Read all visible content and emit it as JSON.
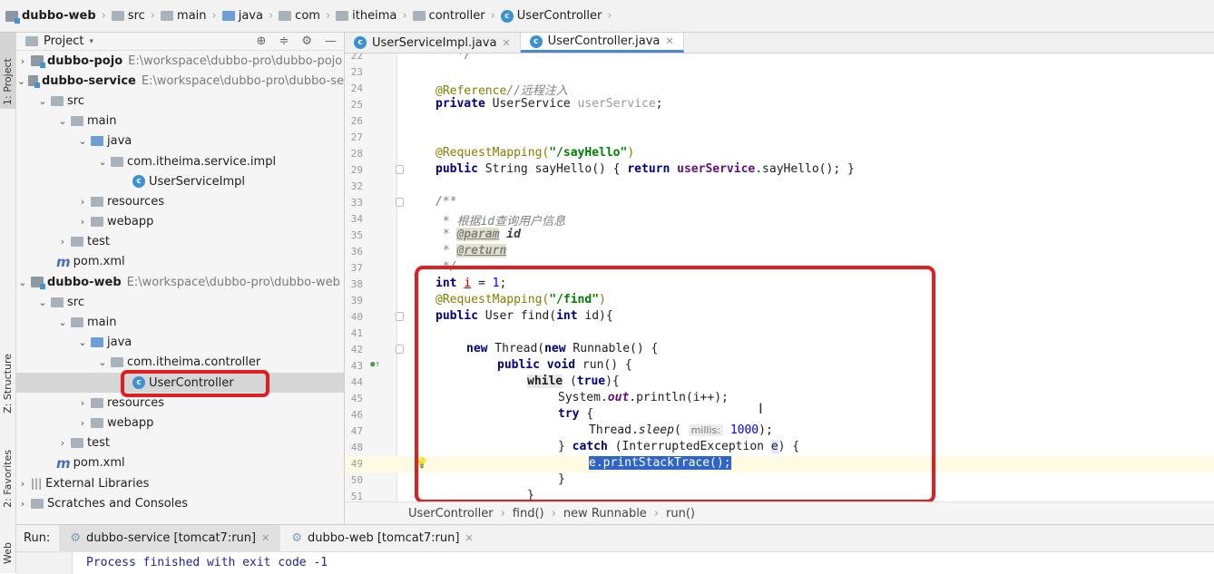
{
  "breadcrumb": [
    "dubbo-web",
    "src",
    "main",
    "java",
    "com",
    "itheima",
    "controller",
    "UserController"
  ],
  "sidebar_tabs": {
    "project": "1: Project",
    "structure": "Z: Structure",
    "favorites": "2: Favorites",
    "web": "Web"
  },
  "project_panel": {
    "title": "Project"
  },
  "tree": [
    {
      "label": "dubbo-pojo",
      "path": "E:\\workspace\\dubbo-pro\\dubbo-pojo"
    },
    {
      "label": "dubbo-service",
      "path": "E:\\workspace\\dubbo-pro\\dubbo-se"
    },
    {
      "label": "src"
    },
    {
      "label": "main"
    },
    {
      "label": "java"
    },
    {
      "label": "com.itheima.service.impl"
    },
    {
      "label": "UserServiceImpl"
    },
    {
      "label": "resources"
    },
    {
      "label": "webapp"
    },
    {
      "label": "test"
    },
    {
      "label": "pom.xml"
    },
    {
      "label": "dubbo-web",
      "path": "E:\\workspace\\dubbo-pro\\dubbo-web"
    },
    {
      "label": "src"
    },
    {
      "label": "main"
    },
    {
      "label": "java"
    },
    {
      "label": "com.itheima.controller"
    },
    {
      "label": "UserController"
    },
    {
      "label": "resources"
    },
    {
      "label": "webapp"
    },
    {
      "label": "test"
    },
    {
      "label": "pom.xml"
    },
    {
      "label": "External Libraries"
    },
    {
      "label": "Scratches and Consoles"
    }
  ],
  "editor_tabs": [
    "UserServiceImpl.java",
    "UserController.java"
  ],
  "line_numbers": [
    "22",
    "23",
    "24",
    "25",
    "26",
    "27",
    "28",
    "29",
    "32",
    "33",
    "34",
    "35",
    "36",
    "37",
    "38",
    "39",
    "40",
    "41",
    "42",
    "43",
    "44",
    "45",
    "46",
    "47",
    "48",
    "49",
    "50",
    "51"
  ],
  "code": {
    "l22": "   */",
    "l24_ann": "@Reference",
    "l24_cm": "//远程注入",
    "l25_kw": "private",
    "l25_type": " UserService ",
    "l25_field": "userService",
    "l25_end": ";",
    "l28_ann": "@RequestMapping(",
    "l28_str": "\"/sayHello\"",
    "l28_end": ")",
    "l29_kw": "public",
    "l29_mid": " String sayHello() { ",
    "l29_kw2": "return",
    "l29_sp": " ",
    "l29_field": "userService",
    "l29_end": ".sayHello(); }",
    "l33": "/**",
    "l34_a": " * 根据",
    "l34_b": "id",
    "l34_c": "查询用户信息",
    "l35_a": " * ",
    "l35_tag": "@param",
    "l35_b": " id",
    "l36_a": " * ",
    "l36_tag": "@return",
    "l37": " */",
    "l38_kw": "int",
    "l38_a": " ",
    "l38_i": "i",
    "l38_b": " = ",
    "l38_num": "1",
    "l38_end": ";",
    "l39_ann": "@RequestMapping(",
    "l39_str": "\"/find\"",
    "l39_end": ")",
    "l40_kw": "public",
    "l40_a": " User find(",
    "l40_kw2": "int",
    "l40_b": " id){",
    "l42_kw": "new",
    "l42_a": " Thread(",
    "l42_kw2": "new",
    "l42_b": " Runnable() {",
    "l43_kw": "public void",
    "l43_a": " run() {",
    "l44_kw": "while",
    "l44_a": " (",
    "l44_kw2": "true",
    "l44_b": "){",
    "l45_a": "System.",
    "l45_out": "out",
    "l45_b": ".println(i++);",
    "l46_kw": "try",
    "l46_a": " {",
    "l47_a": "Thread.",
    "l47_sleep": "sleep",
    "l47_b": "( ",
    "l47_hint": "millis:",
    "l47_c": " ",
    "l47_num": "1000",
    "l47_end": ");",
    "l48_a": "} ",
    "l48_kw": "catch",
    "l48_b": " (InterruptedException ",
    "l48_e": "e",
    "l48_c": ") {",
    "l49_sel": "e.printStackTrace();",
    "l50": "}",
    "l51": "}"
  },
  "nav_breadcrumb": [
    "UserController",
    "find()",
    "new Runnable",
    "run()"
  ],
  "run_panel": {
    "label": "Run:",
    "tabs": [
      "dubbo-service [tomcat7:run]",
      "dubbo-web [tomcat7:run]"
    ],
    "output": "Process finished with exit code -1"
  },
  "colors": {
    "highlight_box": "#e02020",
    "selection": "#2f64c8",
    "keyword": "#000080",
    "annotation": "#808000",
    "string": "#008000"
  }
}
